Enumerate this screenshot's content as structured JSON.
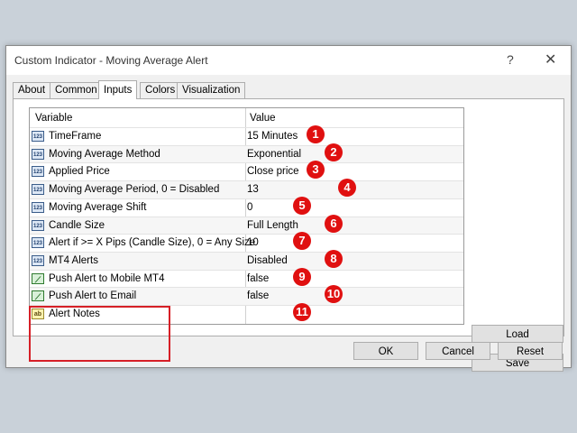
{
  "window": {
    "title": "Custom Indicator - Moving Average Alert",
    "help_label": "?",
    "close_label": "✕"
  },
  "tabs": [
    {
      "label": "About"
    },
    {
      "label": "Common"
    },
    {
      "label": "Inputs"
    },
    {
      "label": "Colors"
    },
    {
      "label": "Visualization"
    }
  ],
  "active_tab": "Inputs",
  "table": {
    "headers": {
      "variable": "Variable",
      "value": "Value"
    },
    "rows": [
      {
        "icon": "123",
        "name": "TimeFrame",
        "value": "15 Minutes",
        "badge": "1"
      },
      {
        "icon": "123",
        "name": "Moving Average Method",
        "value": "Exponential",
        "badge": "2"
      },
      {
        "icon": "123",
        "name": "Applied Price",
        "value": "Close price",
        "badge": "3"
      },
      {
        "icon": "123",
        "name": "Moving Average Period, 0 = Disabled",
        "value": "13",
        "badge": "4"
      },
      {
        "icon": "123",
        "name": "Moving Average Shift",
        "value": "0",
        "badge": "5"
      },
      {
        "icon": "123",
        "name": "Candle Size",
        "value": "Full Length",
        "badge": "6"
      },
      {
        "icon": "123",
        "name": "Alert if >= X Pips (Candle Size), 0 = Any Size",
        "value": "10",
        "badge": "7"
      },
      {
        "icon": "123",
        "name": "MT4 Alerts",
        "value": "Disabled",
        "badge": "8"
      },
      {
        "icon": "toggle",
        "name": "Push Alert to Mobile MT4",
        "value": "false",
        "badge": "9"
      },
      {
        "icon": "toggle",
        "name": "Push Alert to Email",
        "value": "false",
        "badge": "10"
      },
      {
        "icon": "ab",
        "name": "Alert Notes",
        "value": "",
        "badge": "11"
      }
    ]
  },
  "icons": {
    "number": "123",
    "boolean": "toggle-icon",
    "text": "ab"
  },
  "buttons": {
    "load": "Load",
    "save": "Save",
    "ok": "OK",
    "cancel": "Cancel",
    "reset": "Reset"
  },
  "colors": {
    "highlight": "#d61f26",
    "badge": "#e01010"
  }
}
